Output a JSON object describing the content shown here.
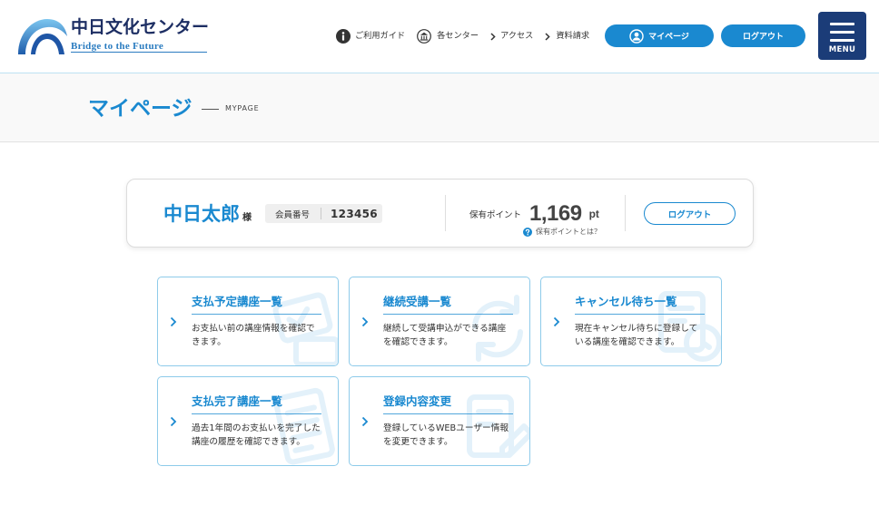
{
  "colors": {
    "primary": "#1a89d0",
    "navy": "#1b3c78",
    "logo_text": "#1d2e63",
    "card_border": "#8ecbea",
    "header_line": "#bde2f2"
  },
  "header": {
    "logo_title": "中日文化センター",
    "logo_tagline": "Bridge to the Future",
    "nav": [
      {
        "label": "ご利用ガイド",
        "icon": "info-icon"
      },
      {
        "label": "各センター",
        "icon": "building-icon"
      },
      {
        "label": "アクセス",
        "icon": "chevron-right-icon"
      },
      {
        "label": "資料請求",
        "icon": "chevron-right-icon"
      }
    ],
    "mypage_button": {
      "label": "マイページ",
      "icon": "user-icon"
    },
    "logout_button": {
      "label": "ログアウト"
    },
    "menu_button": {
      "label": "MENU",
      "icon": "hamburger-icon"
    }
  },
  "page_title": {
    "title": "マイページ",
    "subtitle": "MYPAGE"
  },
  "member": {
    "name": "中日太郎",
    "honorific": "様",
    "number_label": "会員番号",
    "number": "123456",
    "points_label": "保有ポイント",
    "points": "1,169",
    "points_unit": "pt",
    "points_help": "保有ポイントとは？",
    "logout_button": "ログアウト"
  },
  "menu_cards": [
    {
      "title": "支払予定講座一覧",
      "description": "お支払い前の講座情報を確認できます。",
      "icon": "payment-due-icon"
    },
    {
      "title": "継続受講一覧",
      "description": "継続して受講申込ができる講座を確認できます。",
      "icon": "renewal-icon"
    },
    {
      "title": "キャンセル待ち一覧",
      "description": "現在キャンセル待ちに登録している講座を確認できます。",
      "icon": "waitlist-icon"
    },
    {
      "title": "支払完了講座一覧",
      "description": "過去1年間のお支払いを完了した講座の履歴を確認できます。",
      "icon": "payment-history-icon"
    },
    {
      "title": "登録内容変更",
      "description": "登録しているWEBユーザー情報を変更できます。",
      "icon": "edit-profile-icon"
    }
  ]
}
